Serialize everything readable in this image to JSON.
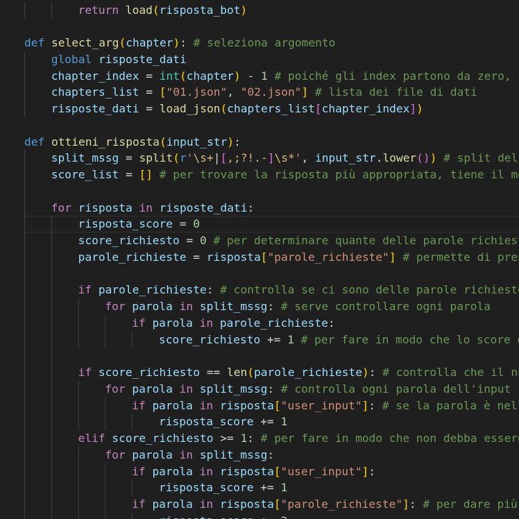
{
  "editor": {
    "language": "python",
    "theme_colors": {
      "background": "#1f1f1f",
      "keyword": "#569cd6",
      "control": "#c586c0",
      "function": "#dcdcaa",
      "variable": "#9cdcfe",
      "string": "#ce9178",
      "number": "#b5cea8",
      "comment": "#6a9955",
      "bracket1": "#ffd700",
      "bracket2": "#da70d6",
      "bracket3": "#179fff"
    },
    "current_line_index": 13,
    "lines": [
      {
        "indent": 2,
        "tokens": [
          [
            "kc",
            "return"
          ],
          [
            "o",
            " "
          ],
          [
            "f",
            "load"
          ],
          [
            "b1",
            "("
          ],
          [
            "v",
            "risposta_bot"
          ],
          [
            "b1",
            ")"
          ]
        ]
      },
      {
        "indent": 0,
        "tokens": []
      },
      {
        "indent": 0,
        "tokens": [
          [
            "k",
            "def"
          ],
          [
            "o",
            " "
          ],
          [
            "f",
            "select_arg"
          ],
          [
            "b1",
            "("
          ],
          [
            "v",
            "chapter"
          ],
          [
            "b1",
            ")"
          ],
          [
            "o",
            ": "
          ],
          [
            "c",
            "# seleziona argomento"
          ]
        ]
      },
      {
        "indent": 1,
        "tokens": [
          [
            "k",
            "global"
          ],
          [
            "o",
            " "
          ],
          [
            "v",
            "risposte_dati"
          ]
        ]
      },
      {
        "indent": 1,
        "tokens": [
          [
            "v",
            "chapter_index"
          ],
          [
            "o",
            " = "
          ],
          [
            "t",
            "int"
          ],
          [
            "b1",
            "("
          ],
          [
            "v",
            "chapter"
          ],
          [
            "b1",
            ")"
          ],
          [
            "o",
            " - "
          ],
          [
            "n",
            "1"
          ],
          [
            "o",
            " "
          ],
          [
            "c",
            "# poiché gli index partono da zero, bisogna"
          ]
        ]
      },
      {
        "indent": 1,
        "tokens": [
          [
            "v",
            "chapters_list"
          ],
          [
            "o",
            " = "
          ],
          [
            "b1",
            "["
          ],
          [
            "s",
            "\"01.json\""
          ],
          [
            "o",
            ", "
          ],
          [
            "s",
            "\"02.json\""
          ],
          [
            "b1",
            "]"
          ],
          [
            "o",
            " "
          ],
          [
            "c",
            "# lista dei file di dati"
          ]
        ]
      },
      {
        "indent": 1,
        "tokens": [
          [
            "v",
            "risposte_dati"
          ],
          [
            "o",
            " = "
          ],
          [
            "f",
            "load_json"
          ],
          [
            "b1",
            "("
          ],
          [
            "v",
            "chapters_list"
          ],
          [
            "b2",
            "["
          ],
          [
            "v",
            "chapter_index"
          ],
          [
            "b2",
            "]"
          ],
          [
            "b1",
            ")"
          ]
        ]
      },
      {
        "indent": 0,
        "tokens": []
      },
      {
        "indent": 0,
        "tokens": [
          [
            "k",
            "def"
          ],
          [
            "o",
            " "
          ],
          [
            "f",
            "ottieni_risposta"
          ],
          [
            "b1",
            "("
          ],
          [
            "v",
            "input_str"
          ],
          [
            "b1",
            ")"
          ],
          [
            "o",
            ":"
          ]
        ]
      },
      {
        "indent": 1,
        "tokens": [
          [
            "v",
            "split_mssg"
          ],
          [
            "o",
            " = "
          ],
          [
            "f",
            "split"
          ],
          [
            "b1",
            "("
          ],
          [
            "k",
            "r"
          ],
          [
            "s",
            "'"
          ],
          [
            "esc",
            "\\s+"
          ],
          [
            "o",
            "|"
          ],
          [
            "b2",
            "["
          ],
          [
            "esc",
            ",;?!.-"
          ],
          [
            "b2",
            "]"
          ],
          [
            "esc",
            "\\s*"
          ],
          [
            "s",
            "'"
          ],
          [
            "o",
            ", "
          ],
          [
            "v",
            "input_str"
          ],
          [
            "o",
            "."
          ],
          [
            "f",
            "lower"
          ],
          [
            "b2",
            "()"
          ],
          [
            "b1",
            ")"
          ],
          [
            "o",
            " "
          ],
          [
            "c",
            "# split delle parole"
          ]
        ]
      },
      {
        "indent": 1,
        "tokens": [
          [
            "v",
            "score_list"
          ],
          [
            "o",
            " = "
          ],
          [
            "b1",
            "[]"
          ],
          [
            "o",
            " "
          ],
          [
            "c",
            "# per trovare la risposta più appropriata, tiene il meglio"
          ]
        ]
      },
      {
        "indent": 0,
        "tokens": []
      },
      {
        "indent": 1,
        "tokens": [
          [
            "kc",
            "for"
          ],
          [
            "o",
            " "
          ],
          [
            "v",
            "risposta"
          ],
          [
            "o",
            " "
          ],
          [
            "kc",
            "in"
          ],
          [
            "o",
            " "
          ],
          [
            "v",
            "risposte_dati"
          ],
          [
            "o",
            ":"
          ]
        ]
      },
      {
        "indent": 2,
        "tokens": [
          [
            "v",
            "risposta_score"
          ],
          [
            "o",
            " = "
          ],
          [
            "n",
            "0"
          ]
        ]
      },
      {
        "indent": 2,
        "tokens": [
          [
            "v",
            "score_richiesto"
          ],
          [
            "o",
            " = "
          ],
          [
            "n",
            "0"
          ],
          [
            "o",
            " "
          ],
          [
            "c",
            "# per determinare quante delle parole richieste"
          ]
        ]
      },
      {
        "indent": 2,
        "tokens": [
          [
            "v",
            "parole_richieste"
          ],
          [
            "o",
            " = "
          ],
          [
            "v",
            "risposta"
          ],
          [
            "b1",
            "["
          ],
          [
            "s",
            "\"parole_richieste\""
          ],
          [
            "b1",
            "]"
          ],
          [
            "o",
            " "
          ],
          [
            "c",
            "# permette di prendere"
          ]
        ]
      },
      {
        "indent": 0,
        "tokens": []
      },
      {
        "indent": 2,
        "tokens": [
          [
            "kc",
            "if"
          ],
          [
            "o",
            " "
          ],
          [
            "v",
            "parole_richieste"
          ],
          [
            "o",
            ": "
          ],
          [
            "c",
            "# controlla se ci sono delle parole richieste"
          ]
        ]
      },
      {
        "indent": 3,
        "tokens": [
          [
            "kc",
            "for"
          ],
          [
            "o",
            " "
          ],
          [
            "v",
            "parola"
          ],
          [
            "o",
            " "
          ],
          [
            "kc",
            "in"
          ],
          [
            "o",
            " "
          ],
          [
            "v",
            "split_mssg"
          ],
          [
            "o",
            ": "
          ],
          [
            "c",
            "# serve controllare ogni parola"
          ]
        ]
      },
      {
        "indent": 4,
        "tokens": [
          [
            "kc",
            "if"
          ],
          [
            "o",
            " "
          ],
          [
            "v",
            "parola"
          ],
          [
            "o",
            " "
          ],
          [
            "kc",
            "in"
          ],
          [
            "o",
            " "
          ],
          [
            "v",
            "parole_richieste"
          ],
          [
            "o",
            ":"
          ]
        ]
      },
      {
        "indent": 5,
        "tokens": [
          [
            "v",
            "score_richiesto"
          ],
          [
            "o",
            " += "
          ],
          [
            "n",
            "1"
          ],
          [
            "o",
            " "
          ],
          [
            "c",
            "# per fare in modo che lo score di"
          ]
        ]
      },
      {
        "indent": 0,
        "tokens": []
      },
      {
        "indent": 2,
        "tokens": [
          [
            "kc",
            "if"
          ],
          [
            "o",
            " "
          ],
          [
            "v",
            "score_richiesto"
          ],
          [
            "o",
            " == "
          ],
          [
            "f",
            "len"
          ],
          [
            "b1",
            "("
          ],
          [
            "v",
            "parole_richieste"
          ],
          [
            "b1",
            ")"
          ],
          [
            "o",
            ": "
          ],
          [
            "c",
            "# controlla che il numero"
          ]
        ]
      },
      {
        "indent": 3,
        "tokens": [
          [
            "kc",
            "for"
          ],
          [
            "o",
            " "
          ],
          [
            "v",
            "parola"
          ],
          [
            "o",
            " "
          ],
          [
            "kc",
            "in"
          ],
          [
            "o",
            " "
          ],
          [
            "v",
            "split_mssg"
          ],
          [
            "o",
            ": "
          ],
          [
            "c",
            "# controlla ogni parola dell'input"
          ]
        ]
      },
      {
        "indent": 4,
        "tokens": [
          [
            "kc",
            "if"
          ],
          [
            "o",
            " "
          ],
          [
            "v",
            "parola"
          ],
          [
            "o",
            " "
          ],
          [
            "kc",
            "in"
          ],
          [
            "o",
            " "
          ],
          [
            "v",
            "risposta"
          ],
          [
            "b1",
            "["
          ],
          [
            "s",
            "\"user_input\""
          ],
          [
            "b1",
            "]"
          ],
          [
            "o",
            ": "
          ],
          [
            "c",
            "# se la parola è nella"
          ]
        ]
      },
      {
        "indent": 5,
        "tokens": [
          [
            "v",
            "risposta_score"
          ],
          [
            "o",
            " += "
          ],
          [
            "n",
            "1"
          ]
        ]
      },
      {
        "indent": 2,
        "tokens": [
          [
            "kc",
            "elif"
          ],
          [
            "o",
            " "
          ],
          [
            "v",
            "score_richiesto"
          ],
          [
            "o",
            " >= "
          ],
          [
            "n",
            "1"
          ],
          [
            "o",
            ": "
          ],
          [
            "c",
            "# per fare in modo che non debba essere"
          ]
        ]
      },
      {
        "indent": 3,
        "tokens": [
          [
            "kc",
            "for"
          ],
          [
            "o",
            " "
          ],
          [
            "v",
            "parola"
          ],
          [
            "o",
            " "
          ],
          [
            "kc",
            "in"
          ],
          [
            "o",
            " "
          ],
          [
            "v",
            "split_mssg"
          ],
          [
            "o",
            ":"
          ]
        ]
      },
      {
        "indent": 4,
        "tokens": [
          [
            "kc",
            "if"
          ],
          [
            "o",
            " "
          ],
          [
            "v",
            "parola"
          ],
          [
            "o",
            " "
          ],
          [
            "kc",
            "in"
          ],
          [
            "o",
            " "
          ],
          [
            "v",
            "risposta"
          ],
          [
            "b1",
            "["
          ],
          [
            "s",
            "\"user_input\""
          ],
          [
            "b1",
            "]"
          ],
          [
            "o",
            ":"
          ]
        ]
      },
      {
        "indent": 5,
        "tokens": [
          [
            "v",
            "risposta_score"
          ],
          [
            "o",
            " += "
          ],
          [
            "n",
            "1"
          ]
        ]
      },
      {
        "indent": 4,
        "tokens": [
          [
            "kc",
            "if"
          ],
          [
            "o",
            " "
          ],
          [
            "v",
            "parola"
          ],
          [
            "o",
            " "
          ],
          [
            "kc",
            "in"
          ],
          [
            "o",
            " "
          ],
          [
            "v",
            "risposta"
          ],
          [
            "b1",
            "["
          ],
          [
            "s",
            "\"parole_richieste\""
          ],
          [
            "b1",
            "]"
          ],
          [
            "o",
            ": "
          ],
          [
            "c",
            "# per dare più"
          ]
        ]
      },
      {
        "indent": 5,
        "tokens": [
          [
            "v",
            "risposta_score"
          ],
          [
            "o",
            " += "
          ],
          [
            "n",
            "2"
          ]
        ]
      }
    ]
  }
}
